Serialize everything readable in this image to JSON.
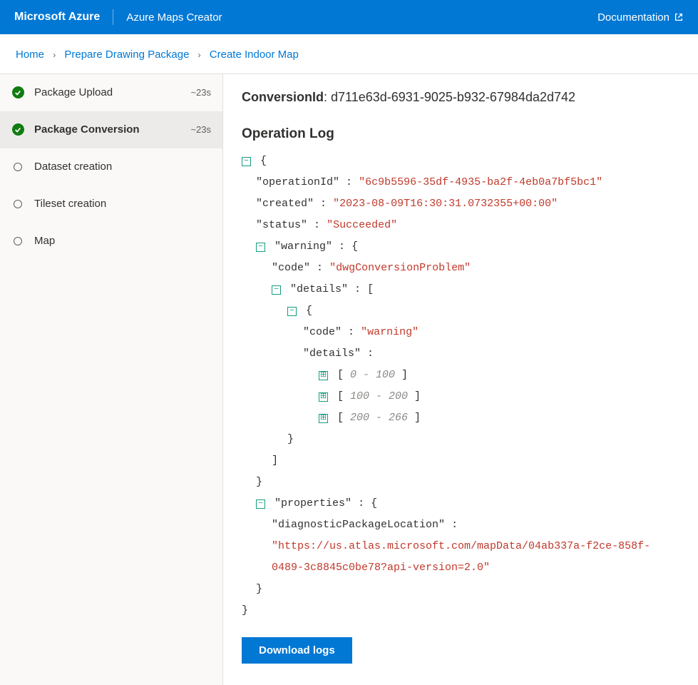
{
  "header": {
    "brand": "Microsoft Azure",
    "app_title": "Azure Maps Creator",
    "doc_link": "Documentation"
  },
  "breadcrumb": {
    "items": [
      "Home",
      "Prepare Drawing Package",
      "Create Indoor Map"
    ]
  },
  "sidebar": {
    "steps": [
      {
        "label": "Package Upload",
        "status": "success",
        "time": "~23s"
      },
      {
        "label": "Package Conversion",
        "status": "success",
        "time": "~23s",
        "current": true
      },
      {
        "label": "Dataset creation",
        "status": "pending",
        "time": ""
      },
      {
        "label": "Tileset creation",
        "status": "pending",
        "time": ""
      },
      {
        "label": "Map",
        "status": "pending",
        "time": ""
      }
    ]
  },
  "content": {
    "conversion_label": "ConversionId",
    "conversion_id": "d711e63d-6931-9025-b932-67984da2d742",
    "operation_log_title": "Operation Log",
    "download_button": "Download logs"
  },
  "log": {
    "operationId_key": "\"operationId\"",
    "operationId_val": "\"6c9b5596-35df-4935-ba2f-4eb0a7bf5bc1\"",
    "created_key": "\"created\"",
    "created_val": "\"2023-08-09T16:30:31.0732355+00:00\"",
    "status_key": "\"status\"",
    "status_val": "\"Succeeded\"",
    "warning_key": "\"warning\"",
    "code_key": "\"code\"",
    "dwg_val": "\"dwgConversionProblem\"",
    "details_key": "\"details\"",
    "inner_code_val": "\"warning\"",
    "range1": "0 - 100",
    "range2": "100 - 200",
    "range3": "200 - 266",
    "properties_key": "\"properties\"",
    "diag_key": "\"diagnosticPackageLocation\"",
    "diag_val": "\"https://us.atlas.microsoft.com/mapData/04ab337a-f2ce-858f-0489-3c8845c0be78?api-version=2.0\""
  }
}
